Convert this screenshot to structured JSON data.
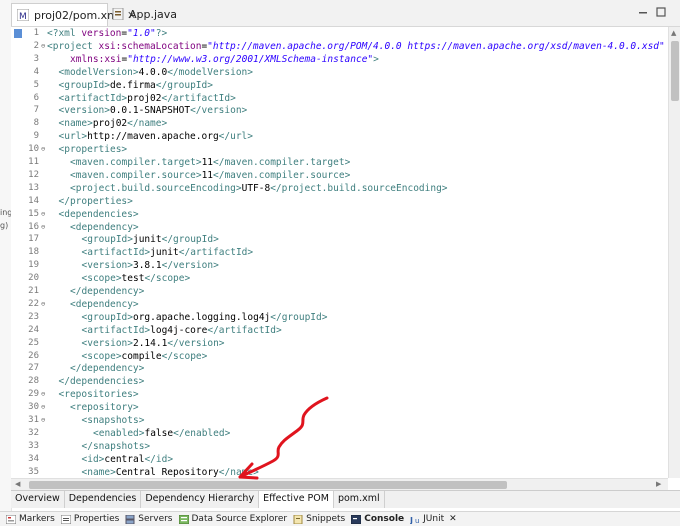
{
  "left_strip": [
    "ing",
    "g)"
  ],
  "editor_tabs": [
    {
      "label": "proj02/pom.xml",
      "icon": "maven-file-icon",
      "active": true,
      "close": "✕"
    },
    {
      "label": "App.java",
      "icon": "java-file-icon",
      "active": false
    }
  ],
  "code_lines": [
    {
      "n": "1",
      "fold": "",
      "indent": 0,
      "parts": [
        [
          "pi",
          "<?xml "
        ],
        [
          "attr",
          "version"
        ],
        [
          "txt",
          "="
        ],
        [
          "str",
          "\"1.0\""
        ],
        [
          "pi",
          "?>"
        ]
      ]
    },
    {
      "n": "2",
      "fold": "⊖",
      "indent": 0,
      "parts": [
        [
          "tag",
          "<project "
        ],
        [
          "attr",
          "xsi:schemaLocation"
        ],
        [
          "txt",
          "="
        ],
        [
          "str",
          "\"http://maven.apache.org/POM/4.0.0 https://maven.apache.org/xsd/maven-4.0.0.xsd\""
        ],
        [
          "txt",
          " "
        ],
        [
          "attr",
          "xmlns"
        ],
        [
          "txt",
          "="
        ],
        [
          "str",
          "\"http://maven.apache.org/POM/4.0.0\""
        ]
      ]
    },
    {
      "n": "3",
      "fold": "",
      "indent": 2,
      "parts": [
        [
          "attr",
          "xmlns:xsi"
        ],
        [
          "txt",
          "="
        ],
        [
          "str",
          "\"http://www.w3.org/2001/XMLSchema-instance\""
        ],
        [
          "tag",
          ">"
        ]
      ]
    },
    {
      "n": "4",
      "fold": "",
      "indent": 1,
      "parts": [
        [
          "tag",
          "<modelVersion>"
        ],
        [
          "txt",
          "4.0.0"
        ],
        [
          "tag",
          "</modelVersion>"
        ]
      ]
    },
    {
      "n": "5",
      "fold": "",
      "indent": 1,
      "parts": [
        [
          "tag",
          "<groupId>"
        ],
        [
          "txt",
          "de.firma"
        ],
        [
          "tag",
          "</groupId>"
        ]
      ]
    },
    {
      "n": "6",
      "fold": "",
      "indent": 1,
      "parts": [
        [
          "tag",
          "<artifactId>"
        ],
        [
          "txt",
          "proj02"
        ],
        [
          "tag",
          "</artifactId>"
        ]
      ]
    },
    {
      "n": "7",
      "fold": "",
      "indent": 1,
      "parts": [
        [
          "tag",
          "<version>"
        ],
        [
          "txt",
          "0.0.1-SNAPSHOT"
        ],
        [
          "tag",
          "</version>"
        ]
      ]
    },
    {
      "n": "8",
      "fold": "",
      "indent": 1,
      "parts": [
        [
          "tag",
          "<name>"
        ],
        [
          "txt",
          "proj02"
        ],
        [
          "tag",
          "</name>"
        ]
      ]
    },
    {
      "n": "9",
      "fold": "",
      "indent": 1,
      "parts": [
        [
          "tag",
          "<url>"
        ],
        [
          "txt",
          "http://maven.apache.org"
        ],
        [
          "tag",
          "</url>"
        ]
      ]
    },
    {
      "n": "10",
      "fold": "⊖",
      "indent": 1,
      "parts": [
        [
          "tag",
          "<properties>"
        ]
      ]
    },
    {
      "n": "11",
      "fold": "",
      "indent": 2,
      "parts": [
        [
          "tag",
          "<maven.compiler.target>"
        ],
        [
          "txt",
          "11"
        ],
        [
          "tag",
          "</maven.compiler.target>"
        ]
      ]
    },
    {
      "n": "12",
      "fold": "",
      "indent": 2,
      "parts": [
        [
          "tag",
          "<maven.compiler.source>"
        ],
        [
          "txt",
          "11"
        ],
        [
          "tag",
          "</maven.compiler.source>"
        ]
      ]
    },
    {
      "n": "13",
      "fold": "",
      "indent": 2,
      "parts": [
        [
          "tag",
          "<project.build.sourceEncoding>"
        ],
        [
          "txt",
          "UTF-8"
        ],
        [
          "tag",
          "</project.build.sourceEncoding>"
        ]
      ]
    },
    {
      "n": "14",
      "fold": "",
      "indent": 1,
      "parts": [
        [
          "tag",
          "</properties>"
        ]
      ]
    },
    {
      "n": "15",
      "fold": "⊖",
      "indent": 1,
      "parts": [
        [
          "tag",
          "<dependencies>"
        ]
      ]
    },
    {
      "n": "16",
      "fold": "⊖",
      "indent": 2,
      "parts": [
        [
          "tag",
          "<dependency>"
        ]
      ]
    },
    {
      "n": "17",
      "fold": "",
      "indent": 3,
      "parts": [
        [
          "tag",
          "<groupId>"
        ],
        [
          "txt",
          "junit"
        ],
        [
          "tag",
          "</groupId>"
        ]
      ]
    },
    {
      "n": "18",
      "fold": "",
      "indent": 3,
      "parts": [
        [
          "tag",
          "<artifactId>"
        ],
        [
          "txt",
          "junit"
        ],
        [
          "tag",
          "</artifactId>"
        ]
      ]
    },
    {
      "n": "19",
      "fold": "",
      "indent": 3,
      "parts": [
        [
          "tag",
          "<version>"
        ],
        [
          "txt",
          "3.8.1"
        ],
        [
          "tag",
          "</version>"
        ]
      ]
    },
    {
      "n": "20",
      "fold": "",
      "indent": 3,
      "parts": [
        [
          "tag",
          "<scope>"
        ],
        [
          "txt",
          "test"
        ],
        [
          "tag",
          "</scope>"
        ]
      ]
    },
    {
      "n": "21",
      "fold": "",
      "indent": 2,
      "parts": [
        [
          "tag",
          "</dependency>"
        ]
      ]
    },
    {
      "n": "22",
      "fold": "⊖",
      "indent": 2,
      "parts": [
        [
          "tag",
          "<dependency>"
        ]
      ]
    },
    {
      "n": "23",
      "fold": "",
      "indent": 3,
      "parts": [
        [
          "tag",
          "<groupId>"
        ],
        [
          "txt",
          "org.apache.logging.log4j"
        ],
        [
          "tag",
          "</groupId>"
        ]
      ]
    },
    {
      "n": "24",
      "fold": "",
      "indent": 3,
      "parts": [
        [
          "tag",
          "<artifactId>"
        ],
        [
          "txt",
          "log4j-core"
        ],
        [
          "tag",
          "</artifactId>"
        ]
      ]
    },
    {
      "n": "25",
      "fold": "",
      "indent": 3,
      "parts": [
        [
          "tag",
          "<version>"
        ],
        [
          "txt",
          "2.14.1"
        ],
        [
          "tag",
          "</version>"
        ]
      ]
    },
    {
      "n": "26",
      "fold": "",
      "indent": 3,
      "parts": [
        [
          "tag",
          "<scope>"
        ],
        [
          "txt",
          "compile"
        ],
        [
          "tag",
          "</scope>"
        ]
      ]
    },
    {
      "n": "27",
      "fold": "",
      "indent": 2,
      "parts": [
        [
          "tag",
          "</dependency>"
        ]
      ]
    },
    {
      "n": "28",
      "fold": "",
      "indent": 1,
      "parts": [
        [
          "tag",
          "</dependencies>"
        ]
      ]
    },
    {
      "n": "29",
      "fold": "⊖",
      "indent": 1,
      "parts": [
        [
          "tag",
          "<repositories>"
        ]
      ]
    },
    {
      "n": "30",
      "fold": "⊖",
      "indent": 2,
      "parts": [
        [
          "tag",
          "<repository>"
        ]
      ]
    },
    {
      "n": "31",
      "fold": "⊖",
      "indent": 3,
      "parts": [
        [
          "tag",
          "<snapshots>"
        ]
      ]
    },
    {
      "n": "32",
      "fold": "",
      "indent": 4,
      "parts": [
        [
          "tag",
          "<enabled>"
        ],
        [
          "txt",
          "false"
        ],
        [
          "tag",
          "</enabled>"
        ]
      ]
    },
    {
      "n": "33",
      "fold": "",
      "indent": 3,
      "parts": [
        [
          "tag",
          "</snapshots>"
        ]
      ]
    },
    {
      "n": "34",
      "fold": "",
      "indent": 3,
      "parts": [
        [
          "tag",
          "<id>"
        ],
        [
          "txt",
          "central"
        ],
        [
          "tag",
          "</id>"
        ]
      ]
    },
    {
      "n": "35",
      "fold": "",
      "indent": 3,
      "parts": [
        [
          "tag",
          "<name>"
        ],
        [
          "txt",
          "Central Repository"
        ],
        [
          "tag",
          "</name>"
        ]
      ]
    }
  ],
  "pom_tabs": [
    {
      "label": "Overview",
      "active": false
    },
    {
      "label": "Dependencies",
      "active": false
    },
    {
      "label": "Dependency Hierarchy",
      "active": false
    },
    {
      "label": "Effective POM",
      "active": true
    },
    {
      "label": "pom.xml",
      "active": false
    }
  ],
  "bottom_views": [
    {
      "label": "Markers",
      "icon": "markers-icon",
      "bold": false
    },
    {
      "label": "Properties",
      "icon": "properties-icon",
      "bold": false
    },
    {
      "label": "Servers",
      "icon": "servers-icon",
      "bold": false
    },
    {
      "label": "Data Source Explorer",
      "icon": "data-source-icon",
      "bold": false
    },
    {
      "label": "Snippets",
      "icon": "snippets-icon",
      "bold": false
    },
    {
      "label": "Console",
      "icon": "console-icon",
      "bold": true
    },
    {
      "label": "JUnit",
      "icon": "junit-icon",
      "bold": false,
      "close": "✕"
    }
  ],
  "annotation": {
    "color": "#e0141e",
    "shape": "hand-drawn arrow pointing to Effective POM tab"
  }
}
